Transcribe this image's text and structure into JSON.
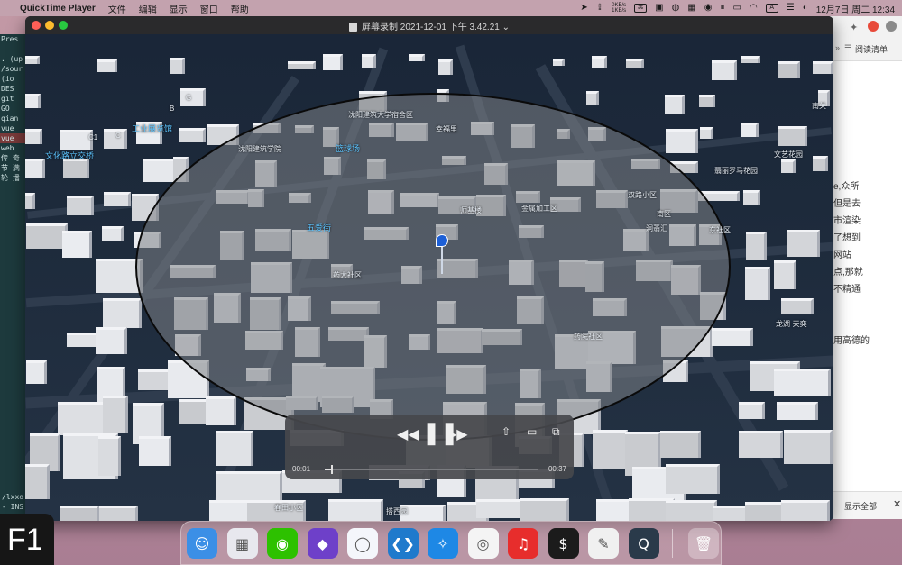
{
  "menubar": {
    "app_name": "QuickTime Player",
    "menus": [
      "文件",
      "编辑",
      "显示",
      "窗口",
      "帮助"
    ],
    "net_up": "0KB/s",
    "net_down": "1KB/s",
    "input_method": "A",
    "clock": "12月7日 周二  12:34"
  },
  "window": {
    "title": "屏幕录制 2021-12-01 下午 3.42.21"
  },
  "map": {
    "labels_blue": [
      "工业展览馆",
      "文化路立交桥",
      "篮球场",
      "五爱街"
    ],
    "labels_white": [
      "沈阳建筑大学宿舍区",
      "沈阳建筑学院",
      "幸福里",
      "师基楼",
      "金属加工区",
      "药大社区",
      "双路小区",
      "南区",
      "洞翡汇",
      "东社区",
      "药院社区",
      "龙湖·天奕",
      "春田小区",
      "搭西园",
      "翡丽罗马花园",
      "文艺花园",
      "南关",
      "C1",
      "B",
      "C",
      "G"
    ]
  },
  "player": {
    "current_time": "00:01",
    "end_time": "00:37",
    "progress": 0.03
  },
  "terminal": {
    "lines": [
      "Pres",
      "",
      ". (up",
      "/sour",
      " (io",
      " DES",
      " git",
      " GO",
      " qian",
      " vue",
      " vue",
      " web",
      " 传 奇",
      " 节 满",
      " 轮 播"
    ]
  },
  "browser": {
    "reading_list": "阅读清单",
    "text_lines": [
      "e,众所",
      "但是去",
      "市渲染",
      "了想到",
      "网站",
      "点,那就",
      "不精通",
      "",
      "",
      "用高德的"
    ],
    "footer_show_all": "显示全部",
    "footer_close": "✕"
  },
  "terminal_bottom": [
    "/lxxo",
    "- INS"
  ],
  "fkey": {
    "label": "F1"
  },
  "dock": {
    "apps": [
      "finder",
      "launchpad",
      "wechat",
      "github",
      "feishu",
      "vscode",
      "safari",
      "chrome",
      "netease-music",
      "terminal",
      "textedit",
      "quicktime",
      "trash"
    ]
  },
  "colors": {
    "circle_fill": "#7d8287",
    "map_bg": "#1d2a3b",
    "blue_label": "#5cc4ff",
    "pin": "#1d5fd6"
  }
}
